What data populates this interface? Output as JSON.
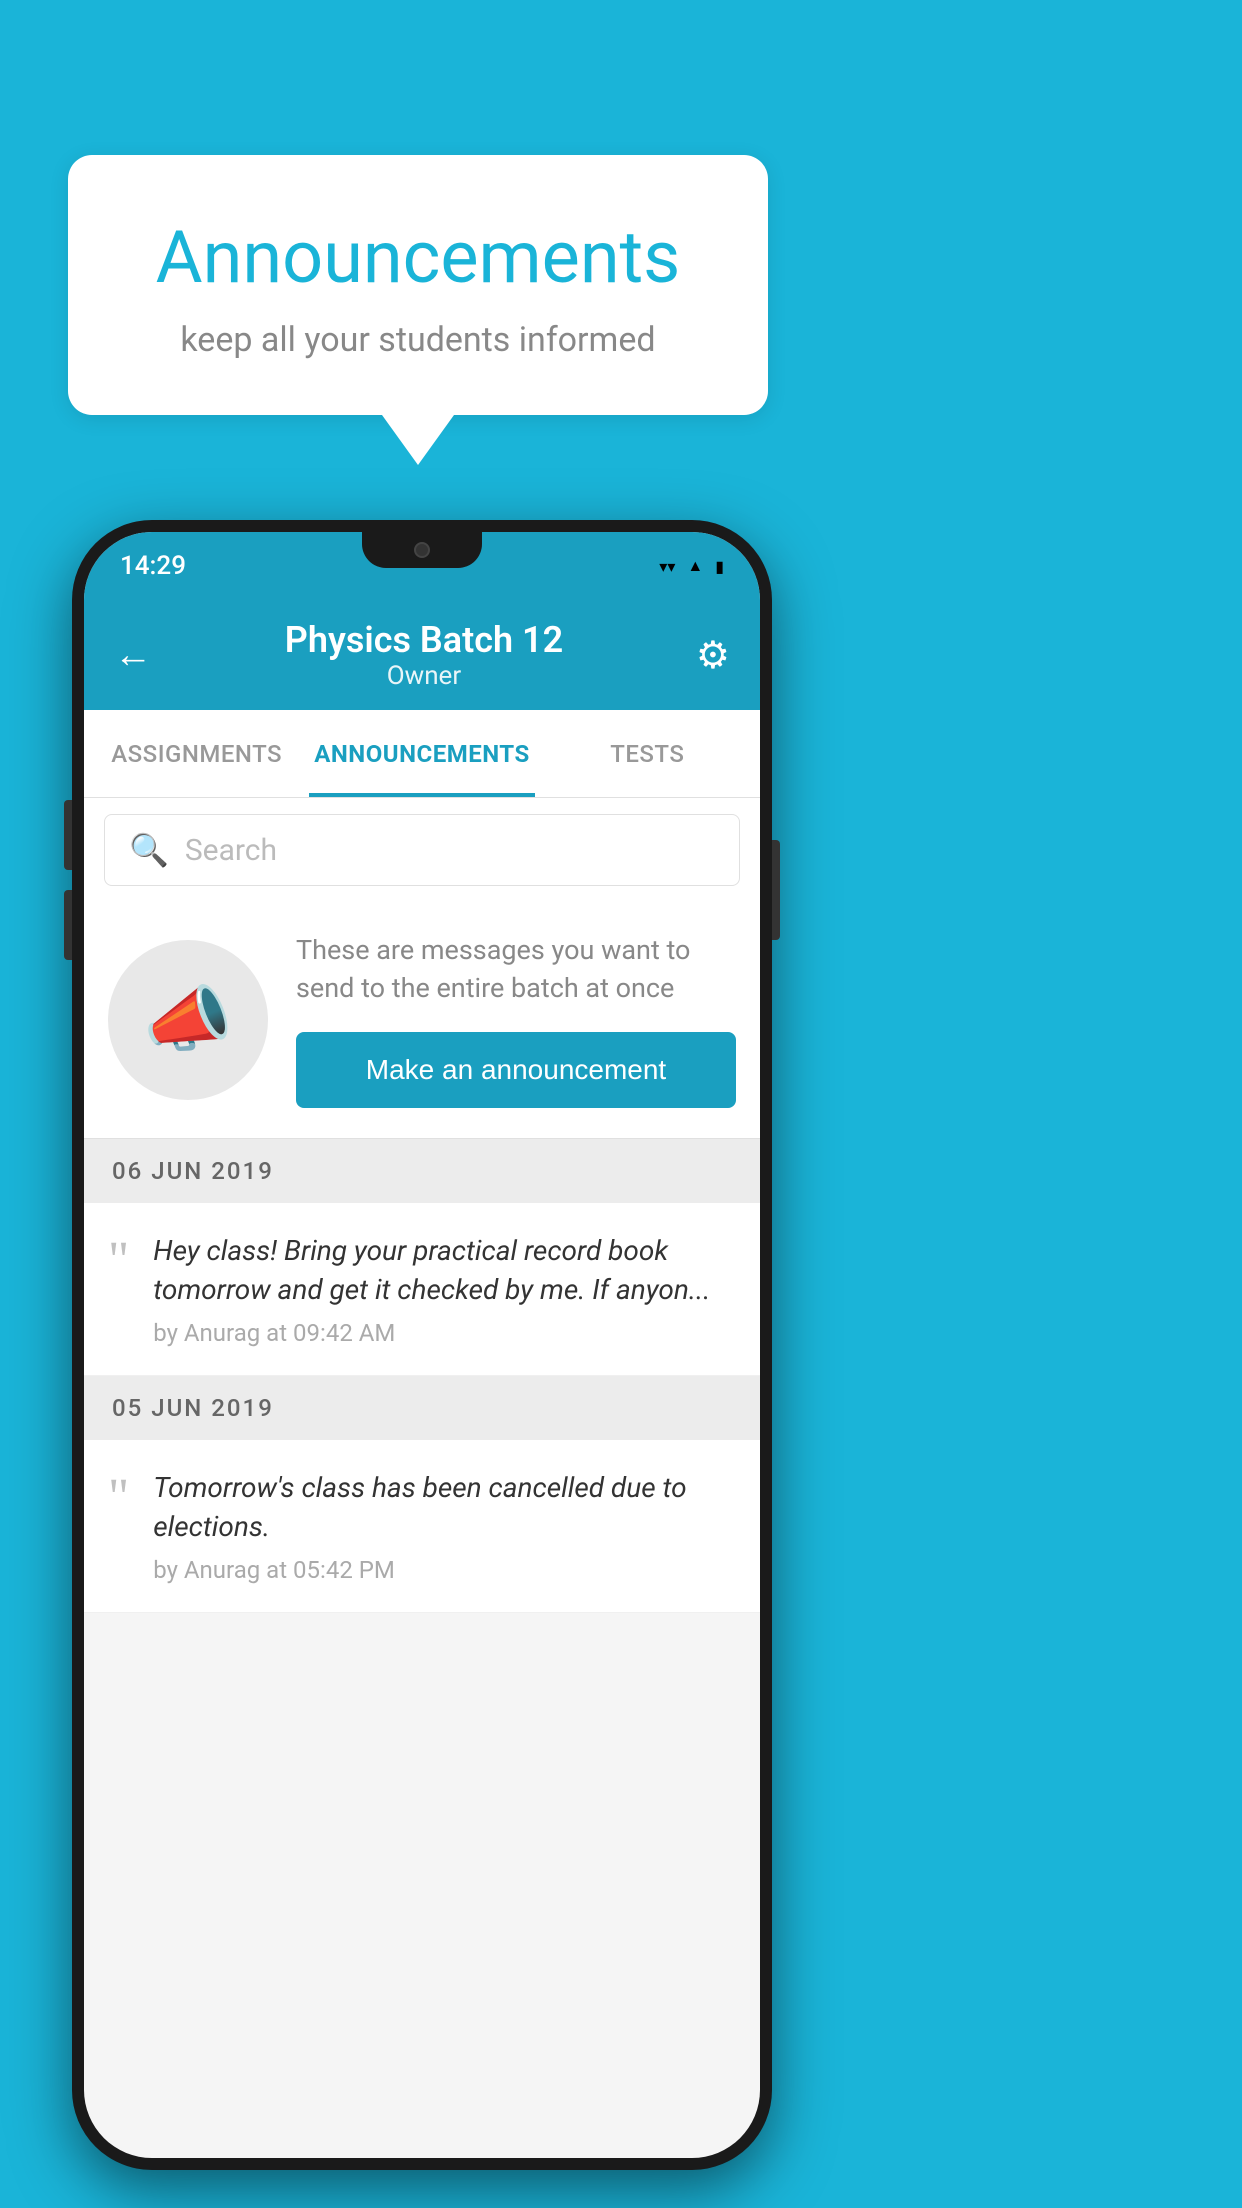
{
  "background_color": "#1ab4d8",
  "speech_bubble": {
    "title": "Announcements",
    "subtitle": "keep all your students informed"
  },
  "phone": {
    "status_bar": {
      "time": "14:29",
      "icons": [
        "wifi",
        "signal",
        "battery"
      ]
    },
    "header": {
      "title": "Physics Batch 12",
      "subtitle": "Owner",
      "back_label": "←",
      "gear_label": "⚙"
    },
    "tabs": [
      {
        "label": "ASSIGNMENTS",
        "active": false
      },
      {
        "label": "ANNOUNCEMENTS",
        "active": true
      },
      {
        "label": "TESTS",
        "active": false
      }
    ],
    "search": {
      "placeholder": "Search"
    },
    "announcement_promo": {
      "description_text": "These are messages you want to send to the entire batch at once",
      "button_label": "Make an announcement"
    },
    "announcements": [
      {
        "date": "06  JUN  2019",
        "message": "Hey class! Bring your practical record book tomorrow and get it checked by me. If anyon...",
        "meta": "by Anurag at 09:42 AM"
      },
      {
        "date": "05  JUN  2019",
        "message": "Tomorrow's class has been cancelled due to elections.",
        "meta": "by Anurag at 05:42 PM"
      }
    ]
  }
}
